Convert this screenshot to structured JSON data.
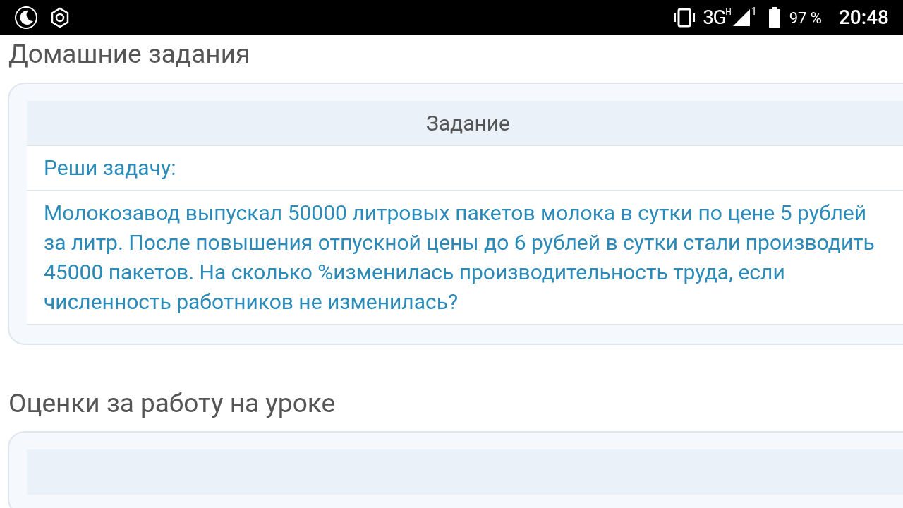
{
  "status_bar": {
    "network": "3G",
    "network_sup": "H",
    "sim": "1",
    "battery": "97 %",
    "time": "20:48"
  },
  "homework": {
    "title": "Домашние задания",
    "table": {
      "column": "Задание",
      "rows": [
        "Реши задачу:",
        "Молокозавод выпускал 50000 литровых пакетов молока в сутки по цене 5 рублей за литр. После повышения отпускной цены до 6 рублей в сутки стали производить 45000 пакетов. На сколько %изменилась производительность труда, если численность работников не изменилась?"
      ]
    }
  },
  "grades": {
    "title": "Оценки за работу на уроке"
  }
}
